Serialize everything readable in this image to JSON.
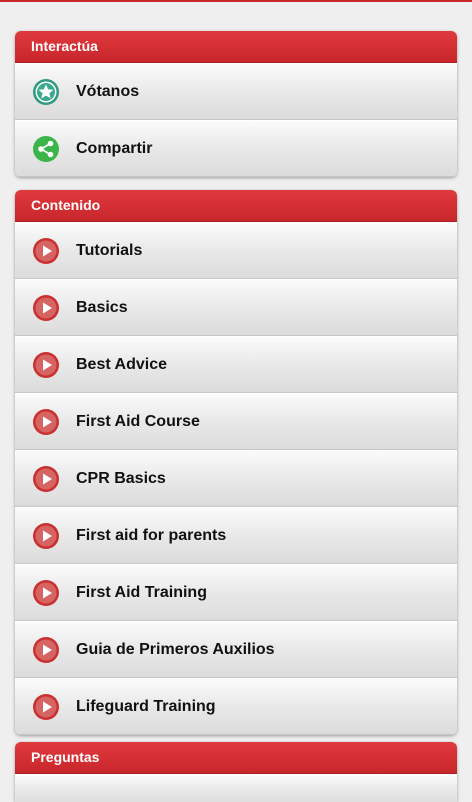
{
  "colors": {
    "accent": "#d32f34",
    "play": "#c9302f",
    "star": "#3aaa8f",
    "share": "#3bb54a"
  },
  "sections": [
    {
      "title": "Interactúa",
      "items": [
        {
          "label": "Vótanos",
          "icon": "star-icon"
        },
        {
          "label": "Compartir",
          "icon": "share-icon"
        }
      ]
    },
    {
      "title": "Contenido",
      "items": [
        {
          "label": "Tutorials",
          "icon": "play-icon"
        },
        {
          "label": "Basics",
          "icon": "play-icon"
        },
        {
          "label": "Best Advice",
          "icon": "play-icon"
        },
        {
          "label": "First Aid Course",
          "icon": "play-icon"
        },
        {
          "label": "CPR Basics",
          "icon": "play-icon"
        },
        {
          "label": "First aid for parents",
          "icon": "play-icon"
        },
        {
          "label": "First Aid Training",
          "icon": "play-icon"
        },
        {
          "label": "Guia de Primeros Auxilios",
          "icon": "play-icon"
        },
        {
          "label": "Lifeguard Training",
          "icon": "play-icon"
        }
      ]
    },
    {
      "title": "Preguntas",
      "items": []
    }
  ]
}
